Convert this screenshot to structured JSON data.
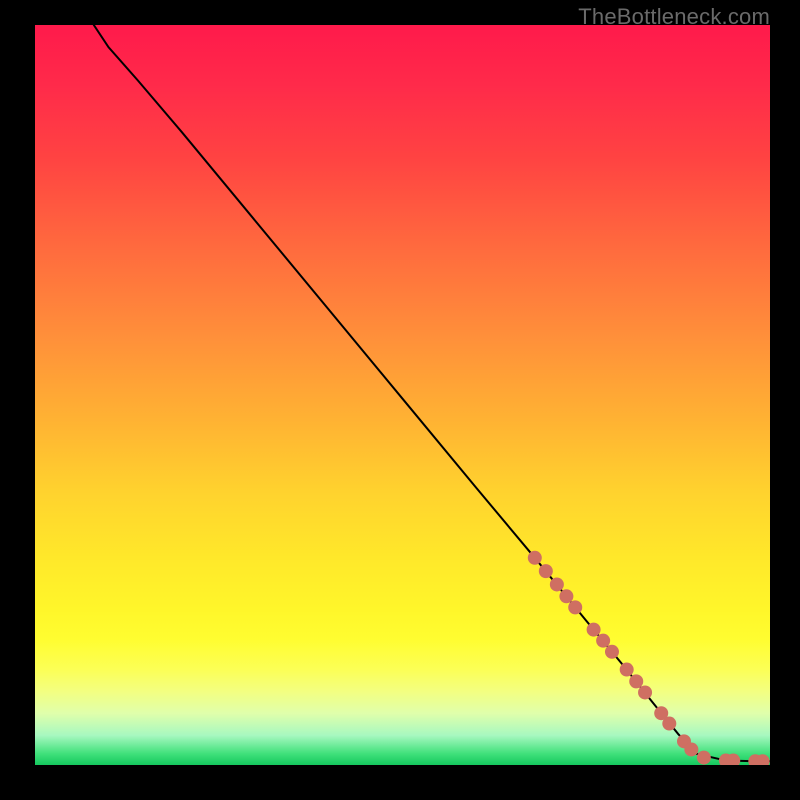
{
  "watermark": "TheBottleneck.com",
  "colors": {
    "line": "#000000",
    "marker": "#cf6f62",
    "bg_black": "#000000"
  },
  "chart_data": {
    "type": "line",
    "title": "",
    "xlabel": "",
    "ylabel": "",
    "xlim": [
      0,
      100
    ],
    "ylim": [
      0,
      100
    ],
    "grid": false,
    "axes_visible": false,
    "series": [
      {
        "name": "curve",
        "x": [
          8,
          10,
          14,
          20,
          30,
          40,
          50,
          60,
          68,
          75,
          80,
          84,
          87.5,
          90,
          94,
          98,
          100
        ],
        "y": [
          100,
          97,
          92.5,
          85.5,
          73.5,
          61.5,
          49.5,
          37.5,
          28,
          19.5,
          13.5,
          8.5,
          4.2,
          1.5,
          0.6,
          0.5,
          0.5
        ]
      }
    ],
    "markers": {
      "name": "highlighted-points",
      "color": "#cf6f62",
      "points": [
        {
          "x": 68.0,
          "y": 28.0
        },
        {
          "x": 69.5,
          "y": 26.2
        },
        {
          "x": 71.0,
          "y": 24.4
        },
        {
          "x": 72.3,
          "y": 22.8
        },
        {
          "x": 73.5,
          "y": 21.3
        },
        {
          "x": 76.0,
          "y": 18.3
        },
        {
          "x": 77.3,
          "y": 16.8
        },
        {
          "x": 78.5,
          "y": 15.3
        },
        {
          "x": 80.5,
          "y": 12.9
        },
        {
          "x": 81.8,
          "y": 11.3
        },
        {
          "x": 83.0,
          "y": 9.8
        },
        {
          "x": 85.2,
          "y": 7.0
        },
        {
          "x": 86.3,
          "y": 5.6
        },
        {
          "x": 88.3,
          "y": 3.2
        },
        {
          "x": 89.3,
          "y": 2.1
        },
        {
          "x": 91.0,
          "y": 1.0
        },
        {
          "x": 94.0,
          "y": 0.6
        },
        {
          "x": 95.0,
          "y": 0.6
        },
        {
          "x": 98.0,
          "y": 0.5
        },
        {
          "x": 99.0,
          "y": 0.5
        }
      ]
    }
  }
}
